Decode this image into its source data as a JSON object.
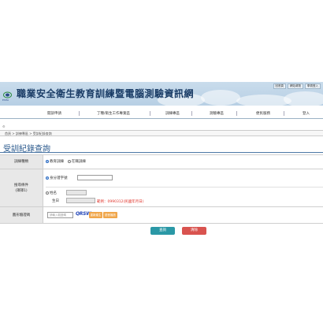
{
  "header": {
    "top_links": [
      "回首頁",
      "網站導覽",
      "學員登入"
    ],
    "logo_text": "ESHA",
    "site_title": "職業安全衛生教育訓練暨電腦測驗資訊網"
  },
  "nav": {
    "items": [
      "開訓申請",
      "丁種/衛生工作專業區",
      "訓練專區",
      "測驗專區",
      "便民服務",
      "登入"
    ]
  },
  "breadcrumb": "首頁 > 訓練專區 > 受訓紀錄查詢",
  "page_title": "受訓紀錄查詢",
  "form": {
    "training_type": {
      "label": "訓練種類",
      "options": [
        {
          "label": "教育訓練",
          "selected": true
        },
        {
          "label": "在職訓練",
          "selected": false
        }
      ]
    },
    "query_condition": {
      "label_line1": "搜尋條件",
      "label_line2": "(擇擇1)",
      "id_option": "身分證字號",
      "name_label": "姓名",
      "birth_label": "生日",
      "birth_hint": "範例：0990312(民國年月日)"
    },
    "captcha": {
      "label": "圖形驗證碼",
      "placeholder": "請輸入驗證碼",
      "image_text": "QRSW",
      "refresh_label": "重新產生驗證碼",
      "audio_label": "語音播放"
    }
  },
  "actions": {
    "search_label": "查詢",
    "clear_label": "清除"
  },
  "colors": {
    "accent": "#2d5b8e",
    "search_button": "#2a98a6",
    "clear_button": "#d9534f",
    "hint_text": "#e0342b",
    "captcha_button": "#f0a64a"
  }
}
